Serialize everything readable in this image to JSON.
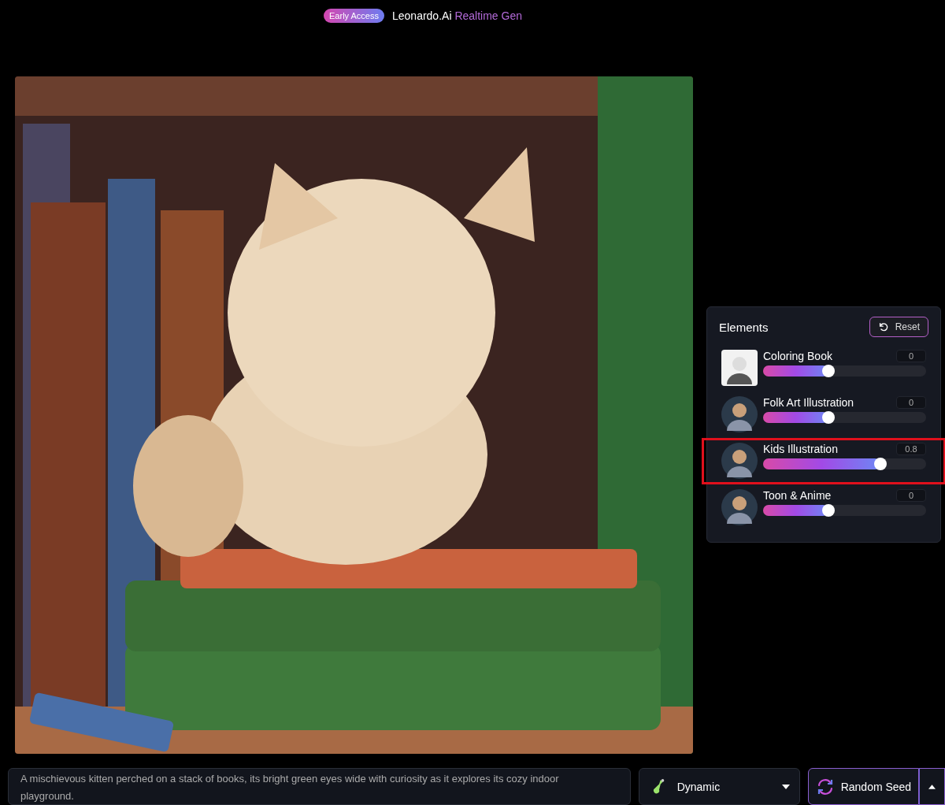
{
  "header": {
    "badge": "Early Access",
    "brand": "Leonardo.Ai",
    "product": "Realtime Gen"
  },
  "elements_panel": {
    "title": "Elements",
    "reset_button": "Reset",
    "items": [
      {
        "name": "Coloring Book",
        "reading": "0",
        "level": 0.4,
        "highlighted": false,
        "kind": "sketch"
      },
      {
        "name": "Folk Art Illustration",
        "reading": "0",
        "level": 0.4,
        "highlighted": false,
        "kind": "color"
      },
      {
        "name": "Kids Illustration",
        "reading": "0.8",
        "level": 0.72,
        "highlighted": true,
        "kind": "color"
      },
      {
        "name": "Toon & Anime",
        "reading": "0",
        "level": 0.4,
        "highlighted": false,
        "kind": "color"
      }
    ]
  },
  "prompt": {
    "value": "A mischievous kitten perched on a stack of books, its bright green eyes wide with curiosity as it explores its cozy indoor playground."
  },
  "style_dropdown": {
    "value": "Dynamic"
  },
  "seed_button": {
    "label": "Random Seed"
  }
}
